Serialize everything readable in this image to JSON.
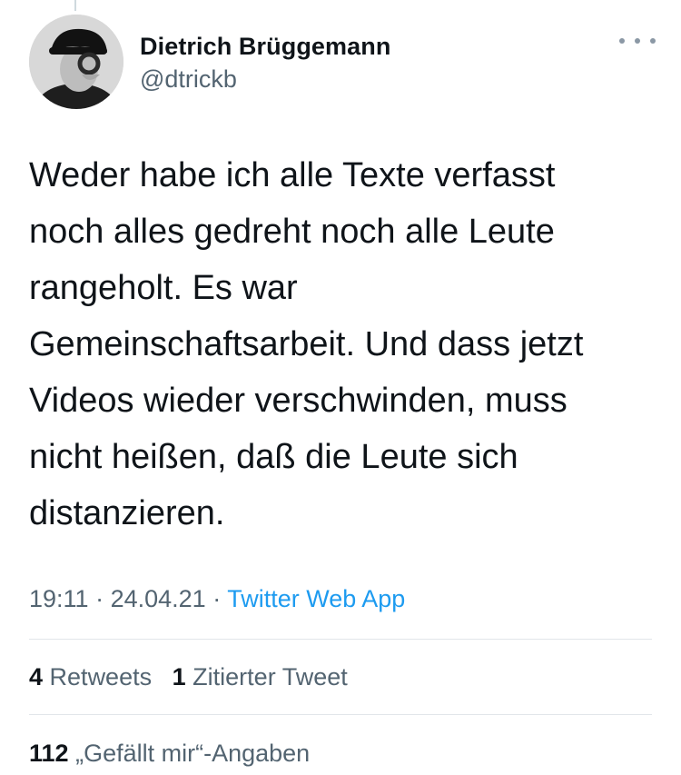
{
  "author": {
    "name": "Dietrich Brüggemann",
    "handle": "@dtrickb"
  },
  "tweet": {
    "text": "Weder habe ich alle Texte verfasst\nnoch alles gedreht noch alle Leute\nrangeholt. Es war\nGemeinschaftsarbeit. Und dass jetzt\nVideos wieder verschwinden, muss\nnicht heißen, daß die Leute sich\ndistanzieren."
  },
  "meta": {
    "time": "19:11",
    "separator": "·",
    "date": "24.04.21",
    "source": "Twitter Web App"
  },
  "stats": {
    "retweets_count": "4",
    "retweets_label": "Retweets",
    "quotes_count": "1",
    "quotes_label": "Zitierter Tweet",
    "likes_count": "112",
    "likes_label": "„Gefällt mir“-Angaben"
  },
  "icons": {
    "more": "more-horizontal-icon"
  }
}
